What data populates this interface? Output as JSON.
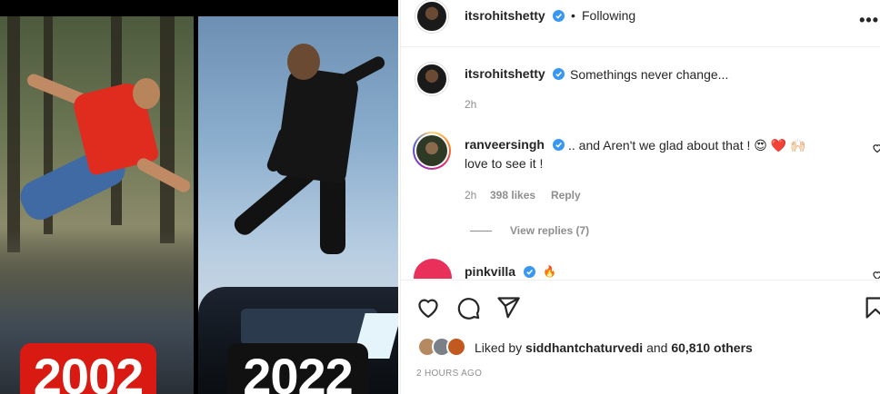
{
  "media": {
    "left_year": "2002",
    "right_year": "2022",
    "left_badge_color": "#d81a12",
    "right_badge_color": "#111111"
  },
  "header": {
    "username": "itsrohitshetty",
    "separator": "•",
    "follow_status": "Following",
    "more_icon": "more-horizontal-icon"
  },
  "caption": {
    "username": "itsrohitshetty",
    "text": "Somethings never change...",
    "time": "2h"
  },
  "comment": {
    "username": "ranveersingh",
    "text_line1": ".. and Aren't we glad about that ! 😍 ❤️ 🙌🏻",
    "text_line2": "love to see it !",
    "time": "2h",
    "likes": "398 likes",
    "reply_label": "Reply",
    "view_replies": "View replies (7)"
  },
  "comment_next": {
    "username": "pinkvilla",
    "emoji": "🔥"
  },
  "actions": {
    "like_icon": "heart-icon",
    "comment_icon": "comment-icon",
    "share_icon": "send-icon",
    "save_icon": "bookmark-icon"
  },
  "likes": {
    "prefix": "Liked by",
    "user": "siddhantchaturvedi",
    "joiner": "and",
    "count": "60,810 others"
  },
  "post_time": "2 HOURS AGO",
  "colors": {
    "verified": "#3897f0",
    "muted": "#8e8e8e",
    "text": "#262626"
  }
}
